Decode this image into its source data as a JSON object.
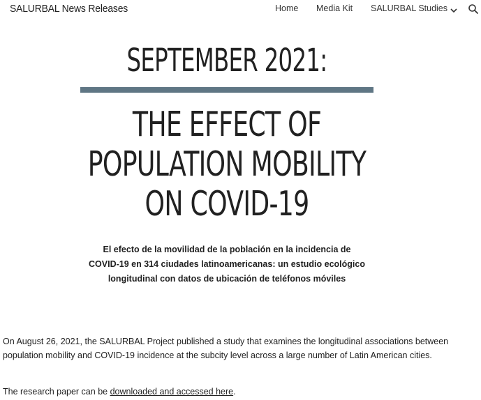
{
  "header": {
    "site_title": "SALURBAL News Releases",
    "nav": {
      "home": "Home",
      "media_kit": "Media Kit",
      "studies": "SALURBAL Studies"
    },
    "icons": [
      "chevron-down-icon",
      "search-icon"
    ]
  },
  "main": {
    "heading_1": "SEPTEMBER 2021:",
    "rule_color": "#5f7684",
    "heading_2_lines": [
      "THE EFFECT OF",
      "POPULATION MOBILITY",
      "ON COVID-19"
    ],
    "subtitle": "El efecto de la movilidad de la población en la incidencia de COVID-19 en 314 ciudades latinoamericanas: un estudio ecológico longitudinal con datos de ubicación de teléfonos móviles",
    "paragraph_1": "On August 26, 2021, the SALURBAL Project published a study that examines the longitudinal associations between population mobility and COVID-19 incidence at the subcity level across a large number of Latin American cities.",
    "paragraph_2_prefix": "The research paper can be ",
    "paragraph_2_link": "downloaded and accessed here",
    "paragraph_2_suffix": "."
  }
}
